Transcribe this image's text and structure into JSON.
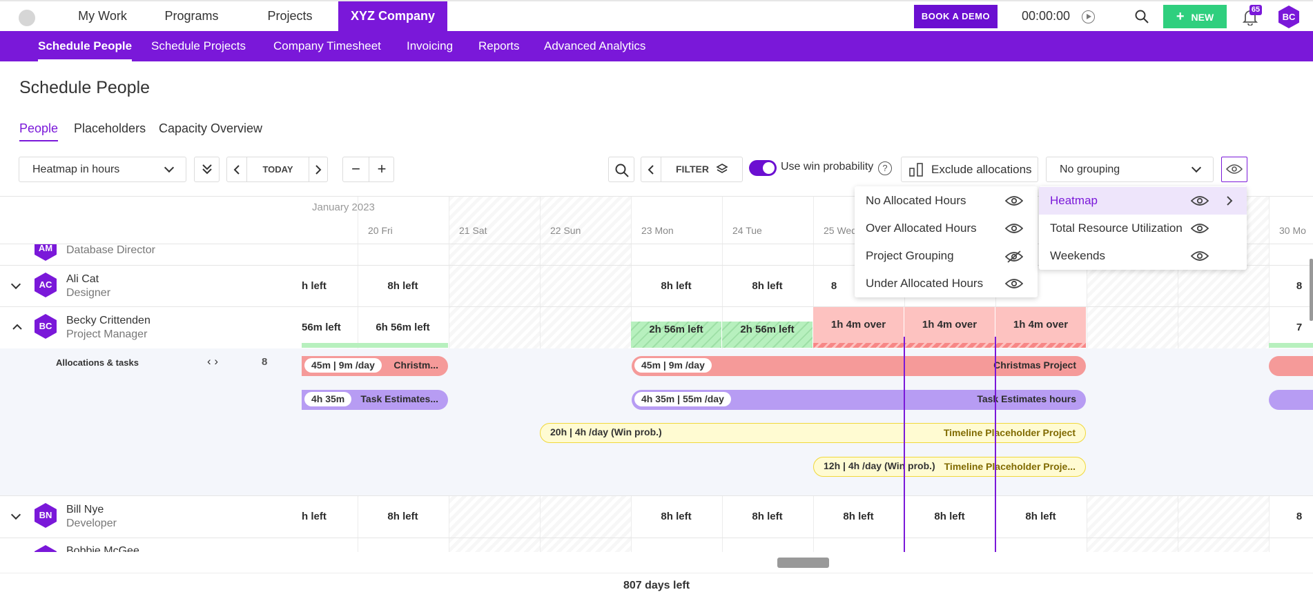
{
  "topnav": {
    "items": [
      "My Work",
      "Programs",
      "Projects",
      "XYZ Company"
    ],
    "book_demo": "BOOK A DEMO",
    "timer": "00:00:00",
    "new_label": "NEW",
    "notif_count": "65",
    "avatar": "BC"
  },
  "subnav": [
    "Schedule People",
    "Schedule Projects",
    "Company Timesheet",
    "Invoicing",
    "Reports",
    "Advanced Analytics"
  ],
  "page_title": "Schedule People",
  "tabs": [
    "People",
    "Placeholders",
    "Capacity Overview"
  ],
  "toolbar": {
    "view": "Heatmap in hours",
    "today": "TODAY",
    "filter": "FILTER",
    "win_prob": "Use win probability",
    "exclude": "Exclude allocations",
    "grouping": "No grouping"
  },
  "calendar": {
    "month": "January 2023",
    "days": [
      "20 Fri",
      "21 Sat",
      "22 Sun",
      "23 Mon",
      "24 Tue",
      "25 Wed",
      "30 Mo"
    ]
  },
  "people": [
    {
      "initials": "AM",
      "name": "",
      "role": "Database Director"
    },
    {
      "initials": "AC",
      "name": "Ali Cat",
      "role": "Designer"
    },
    {
      "initials": "BC",
      "name": "Becky Crittenden",
      "role": "Project Manager"
    },
    {
      "initials": "BN",
      "name": "Bill Nye",
      "role": "Developer"
    },
    {
      "initials": "",
      "name": "Bobbie McGee",
      "role": ""
    }
  ],
  "cells": {
    "left8": "8h left",
    "left8_cut": "h left",
    "over": "1h 4m over",
    "left656": "6h 56m left",
    "left656_cut": "56m left",
    "left256": "2h 56m left",
    "partial_8": "8",
    "partial_7": "7"
  },
  "alloc": {
    "label": "Allocations & tasks",
    "count": "8",
    "bars": [
      {
        "pill": "45m | 9m /day",
        "label": "Christm..."
      },
      {
        "pill": "45m | 9m /day",
        "label": "Christmas Project"
      },
      {
        "pill": "4h 35m",
        "label": "Task Estimates..."
      },
      {
        "pill": "4h 35m | 55m /day",
        "label": "Task Estimates hours"
      },
      {
        "pill": "20h | 4h /day (Win prob.)",
        "label": "Timeline Placeholder Project"
      },
      {
        "pill": "12h | 4h /day (Win prob.)",
        "label": "Timeline Placeholder Proje..."
      }
    ]
  },
  "menu_left": [
    "No Allocated Hours",
    "Over Allocated Hours",
    "Project Grouping",
    "Under Allocated Hours"
  ],
  "menu_right": [
    "Heatmap",
    "Total Resource Utilization",
    "Weekends"
  ],
  "footer": "807 days left",
  "colors": {
    "accent": "#7a18d9",
    "green": "#2fcf7e",
    "over": "#f59a99",
    "under": "#b7f0be"
  }
}
